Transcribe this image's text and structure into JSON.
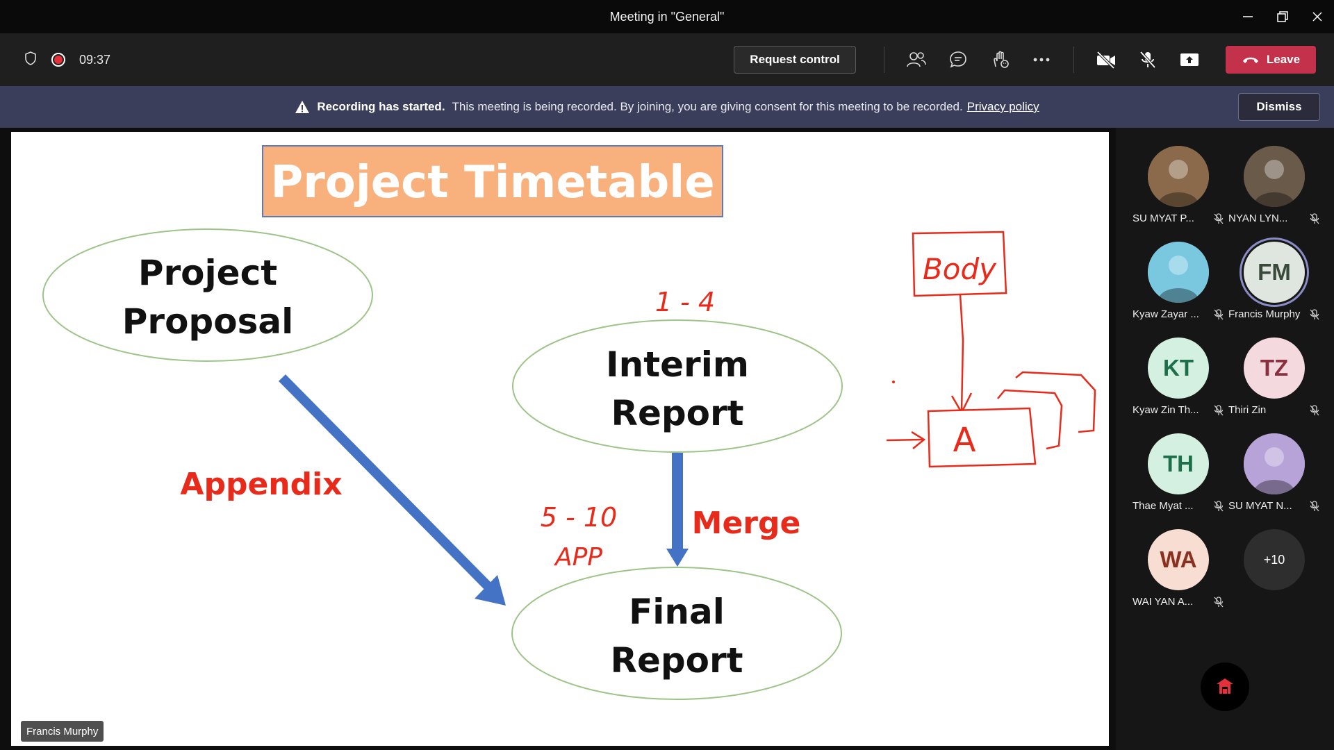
{
  "window": {
    "title": "Meeting in \"General\""
  },
  "toolbar": {
    "timer": "09:37",
    "request_control": "Request control",
    "leave": "Leave"
  },
  "banner": {
    "bold": "Recording has started.",
    "text": "This meeting is being recorded. By joining, you are giving consent for this meeting to be recorded.",
    "link": "Privacy policy",
    "dismiss": "Dismiss"
  },
  "slide": {
    "title": "Project Timetable",
    "proposal_l1": "Project",
    "proposal_l2": "Proposal",
    "interim_l1": "Interim",
    "interim_l2": "Report",
    "final_l1": "Final",
    "final_l2": "Report",
    "appendix": "Appendix",
    "merge": "Merge",
    "hand_1_4": "1 - 4",
    "hand_5_10": "5 - 10",
    "hand_app": "APP",
    "hand_body": "Body",
    "hand_a": "A"
  },
  "presenter": "Francis Murphy",
  "colors": {
    "accent_red": "#e82a1b",
    "arrow_blue": "#4472c4",
    "title_box": "#f8b07d",
    "leave": "#c4314b",
    "banner": "#3b3e5a"
  },
  "participants": [
    {
      "name": "SU MYAT P...",
      "initials": "",
      "bg": "#8a6a4a",
      "photo": true
    },
    {
      "name": "NYAN LYN...",
      "initials": "",
      "bg": "#6a5a4a",
      "photo": true
    },
    {
      "name": "Kyaw Zayar ...",
      "initials": "",
      "bg": "#7ac8e0",
      "photo": true
    },
    {
      "name": "Francis Murphy",
      "initials": "FM",
      "bg": "#dfe5df",
      "ring": true
    },
    {
      "name": "Kyaw Zin Th...",
      "initials": "KT",
      "bg": "#d3f0e0"
    },
    {
      "name": "Thiri Zin",
      "initials": "TZ",
      "bg": "#f4d9de"
    },
    {
      "name": "Thae Myat ...",
      "initials": "TH",
      "bg": "#d3f0e0"
    },
    {
      "name": "SU MYAT N...",
      "initials": "",
      "bg": "#b7a3d8",
      "photo": true
    },
    {
      "name": "WAI YAN A...",
      "initials": "WA",
      "bg": "#f7ddd2"
    },
    {
      "name": "",
      "initials": "+10",
      "bg": "#2e2e2e",
      "more": true
    }
  ]
}
